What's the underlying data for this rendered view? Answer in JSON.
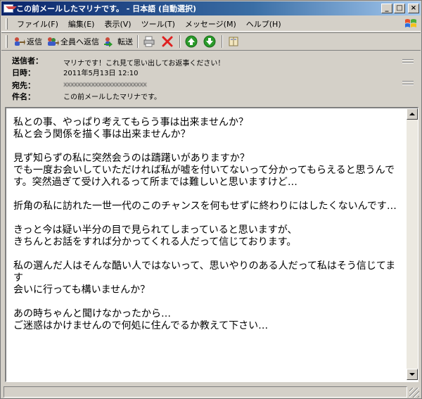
{
  "window": {
    "title": "この前メールしたマリナです。 - 日本語 (自動選択)",
    "buttons": {
      "minimize": "_",
      "maximize": "□",
      "close": "×"
    }
  },
  "menu": [
    "ファイル(F)",
    "編集(E)",
    "表示(V)",
    "ツール(T)",
    "メッセージ(M)",
    "ヘルプ(H)"
  ],
  "toolbar": {
    "reply": "返信",
    "reply_all": "全員へ返信",
    "forward": "転送"
  },
  "headers": {
    "from_label": "送信者：",
    "from_value": "マリナです！これ見て思い出してお返事ください！",
    "date_label": "日時：",
    "date_value": "2011年5月13日 12:10",
    "to_label": "宛先：",
    "to_value": "xxxxxxxxxxxxxxxxxxxxxxxx",
    "subject_label": "件名：",
    "subject_value": "この前メールしたマリナです。"
  },
  "body": "私との事、やっぱり考えてもらう事は出来ませんか？\n私と会う関係を描く事は出来ませんか？\n\n見ず知らずの私に突然会うのは躊躇いがありますか？\nでも一度お会いしていただければ私が嘘を付いてないって分かってもらえると思うんです。突然過ぎて受け入れるって所までは難しいと思いますけど…\n\n折角の私に訪れた一世一代のこのチャンスを何もせずに終わりにはしたくないんです…\n\nきっと今は疑い半分の目で見られてしまっていると思いますが、\nきちんとお話をすれば分かってくれる人だって信じております。\n\n私の選んだ人はそんな酷い人ではないって、思いやりのある人だって私はそう信じてます\n会いに行っても構いませんか？\n\nあの時ちゃんと聞けなかったから…\nご迷惑はかけませんので何処に住んでるか教えて下さい…",
  "icons": {
    "reply": "reply-icon",
    "reply_all": "reply-all-icon",
    "forward": "forward-icon",
    "print": "print-icon",
    "delete": "delete-icon",
    "previous": "previous-icon",
    "next": "next-icon",
    "addresses": "address-book-icon"
  },
  "colors": {
    "titlebar_start": "#0a246a",
    "titlebar_end": "#a6caf0",
    "delete": "#e02020",
    "arrow_green": "#2a9a2a"
  }
}
